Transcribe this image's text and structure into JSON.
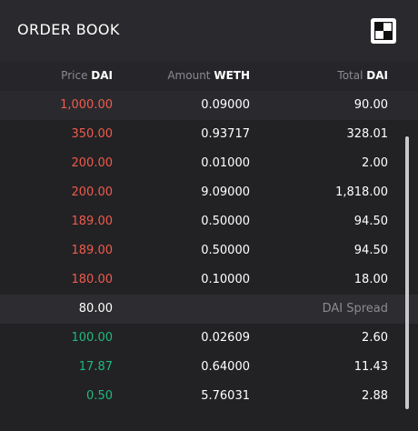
{
  "header": {
    "title": "ORDER BOOK"
  },
  "columns": {
    "price_label": "Price",
    "price_unit": "DAI",
    "amount_label": "Amount",
    "amount_unit": "WETH",
    "total_label": "Total",
    "total_unit": "DAI"
  },
  "asks": [
    {
      "price": "1,000.00",
      "amount": "0.09000",
      "total": "90.00"
    },
    {
      "price": "350.00",
      "amount": "0.93717",
      "total": "328.01"
    },
    {
      "price": "200.00",
      "amount": "0.01000",
      "total": "2.00"
    },
    {
      "price": "200.00",
      "amount": "9.09000",
      "total": "1,818.00"
    },
    {
      "price": "189.00",
      "amount": "0.50000",
      "total": "94.50"
    },
    {
      "price": "189.00",
      "amount": "0.50000",
      "total": "94.50"
    },
    {
      "price": "180.00",
      "amount": "0.10000",
      "total": "18.00"
    }
  ],
  "spread": {
    "value": "80.00",
    "label": "DAI Spread"
  },
  "bids": [
    {
      "price": "100.00",
      "amount": "0.02609",
      "total": "2.60"
    },
    {
      "price": "17.87",
      "amount": "0.64000",
      "total": "11.43"
    },
    {
      "price": "0.50",
      "amount": "5.76031",
      "total": "2.88"
    }
  ],
  "colors": {
    "ask": "#ef5b4c",
    "bid": "#1fb97a",
    "background": "#222225",
    "header": "#2a2a2e"
  },
  "icons": {
    "expand": "expand-icon"
  }
}
